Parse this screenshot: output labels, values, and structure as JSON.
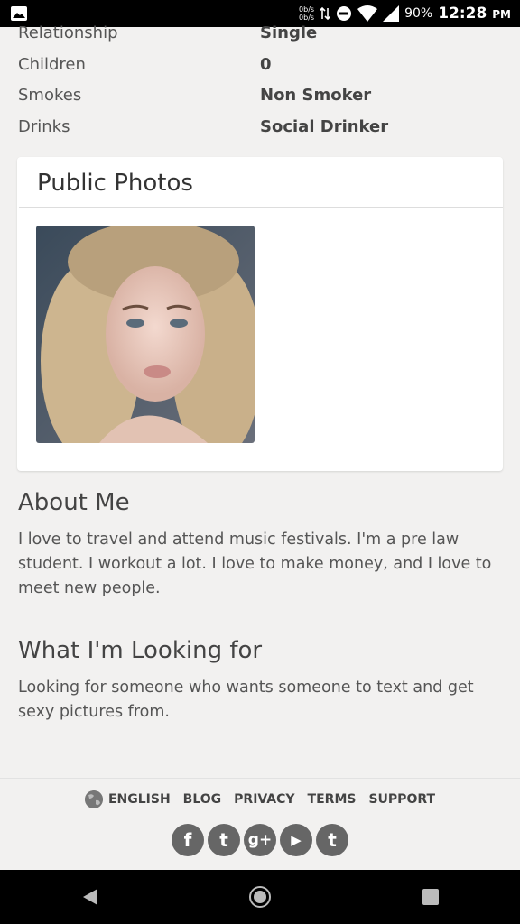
{
  "status_bar": {
    "net_up": "0b/s",
    "net_down": "0b/s",
    "battery": "90%",
    "time": "12:28",
    "ampm": "PM",
    "icons": [
      "image-icon",
      "data-arrows-icon",
      "dnd-icon",
      "wifi-icon",
      "signal-icon"
    ]
  },
  "details": [
    {
      "label": "Relationship",
      "value": "Single"
    },
    {
      "label": "Children",
      "value": "0"
    },
    {
      "label": "Smokes",
      "value": "Non Smoker"
    },
    {
      "label": "Drinks",
      "value": "Social Drinker"
    }
  ],
  "photos": {
    "title": "Public Photos"
  },
  "about": {
    "title": "About Me",
    "text": "I love to travel and attend music festivals. I'm a pre law student. I workout a lot. I love to make money, and I love to meet new people."
  },
  "looking": {
    "title": "What I'm Looking for",
    "text": "Looking for someone who wants someone to text and get sexy pictures from."
  },
  "footer": {
    "language": "ENGLISH",
    "links": [
      "BLOG",
      "PRIVACY",
      "TERMS",
      "SUPPORT"
    ],
    "socials": [
      {
        "name": "facebook-icon",
        "glyph": "f"
      },
      {
        "name": "twitter-icon",
        "glyph": "t"
      },
      {
        "name": "google-plus-icon",
        "glyph": "g+"
      },
      {
        "name": "youtube-icon",
        "glyph": "▶"
      },
      {
        "name": "tumblr-icon",
        "glyph": "t"
      }
    ]
  },
  "colors": {
    "background": "#f2f1f0",
    "card": "#ffffff",
    "social_icon": "#666666"
  }
}
